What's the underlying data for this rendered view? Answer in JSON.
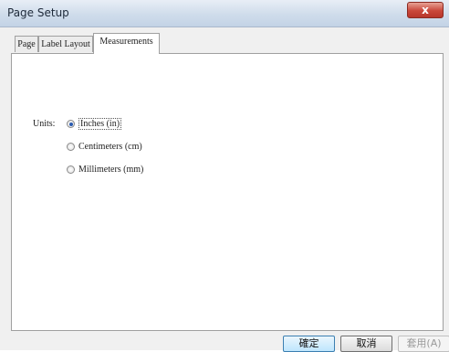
{
  "window": {
    "title": "Page Setup",
    "close_label": "x"
  },
  "tabs": [
    {
      "label": "Page"
    },
    {
      "label": "Label Layout"
    },
    {
      "label": "Measurements"
    }
  ],
  "measurements": {
    "units_label": "Units:",
    "options": [
      {
        "label": "Inches (in)",
        "checked": true
      },
      {
        "label": "Centimeters (cm)",
        "checked": false
      },
      {
        "label": "Millimeters (mm)",
        "checked": false
      }
    ]
  },
  "buttons": {
    "ok": "確定",
    "cancel": "取消",
    "apply": "套用(A)"
  }
}
